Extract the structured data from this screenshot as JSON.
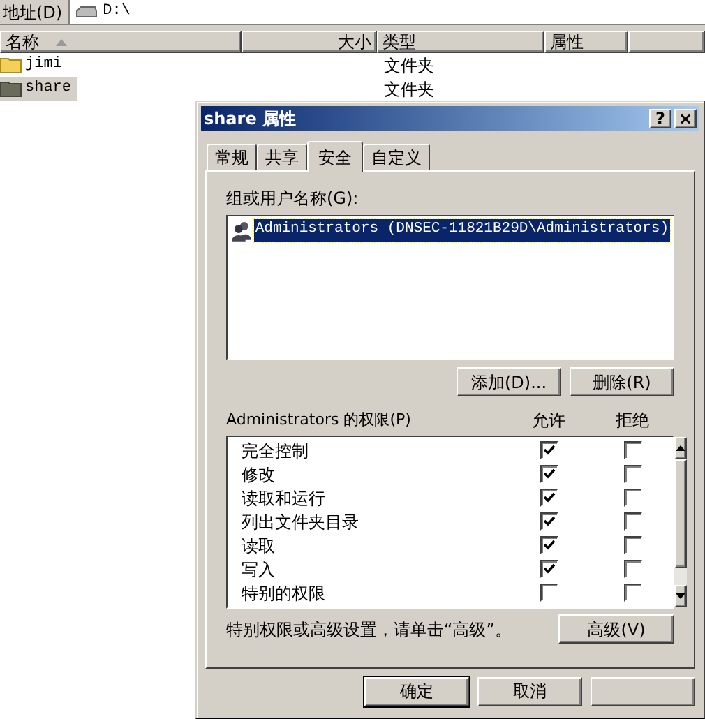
{
  "address_bar": {
    "label": "地址(D)",
    "path": "D:\\"
  },
  "file_list": {
    "columns": [
      {
        "label": "名称",
        "sorted": true
      },
      {
        "label": "大小",
        "sorted": false
      },
      {
        "label": "类型",
        "sorted": false
      },
      {
        "label": "属性",
        "sorted": false
      }
    ],
    "rows": [
      {
        "name": "jimi",
        "type": "文件夹",
        "selected": false
      },
      {
        "name": "share",
        "type": "文件夹",
        "selected": true
      }
    ]
  },
  "dialog": {
    "title": "share 属性",
    "help": "?",
    "close": "×",
    "tabs": [
      {
        "label": "常规",
        "selected": false
      },
      {
        "label": "共享",
        "selected": false
      },
      {
        "label": "安全",
        "selected": true
      },
      {
        "label": "自定义",
        "selected": false
      }
    ],
    "group_label": "组或用户名称(G):",
    "users": [
      {
        "name": "Administrators (DNSEC-11821B29D\\Administrators)",
        "selected": true
      }
    ],
    "add_button": "添加(D)...",
    "remove_button": "删除(R)",
    "permissions_label": "Administrators 的权限(P)",
    "allow_header": "允许",
    "deny_header": "拒绝",
    "permissions": [
      {
        "name": "完全控制",
        "allow": true,
        "deny": false
      },
      {
        "name": "修改",
        "allow": true,
        "deny": false
      },
      {
        "name": "读取和运行",
        "allow": true,
        "deny": false
      },
      {
        "name": "列出文件夹目录",
        "allow": true,
        "deny": false
      },
      {
        "name": "读取",
        "allow": true,
        "deny": false
      },
      {
        "name": "写入",
        "allow": true,
        "deny": false
      },
      {
        "name": "特别的权限",
        "allow": false,
        "deny": false
      }
    ],
    "advanced_note": "特别权限或高级设置，请单击“高级”。",
    "advanced_button": "高级(V)",
    "footer_buttons": [
      "确定",
      "取消"
    ]
  }
}
